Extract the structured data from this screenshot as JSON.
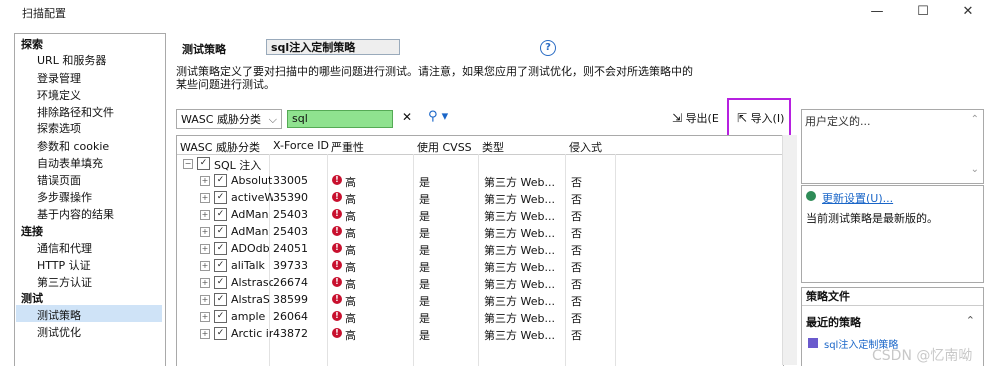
{
  "window": {
    "title": "扫描配置",
    "min": "—",
    "max": "☐",
    "close": "✕"
  },
  "nav": {
    "sections": [
      {
        "label": "探索",
        "items": [
          "URL 和服务器",
          "登录管理",
          "环境定义",
          "排除路径和文件",
          "探索选项",
          "参数和 cookie",
          "自动表单填充",
          "错误页面",
          "多步骤操作",
          "基于内容的结果"
        ]
      },
      {
        "label": "连接",
        "items": [
          "通信和代理",
          "HTTP 认证",
          "第三方认证"
        ]
      },
      {
        "label": "测试",
        "items": [
          "测试策略",
          "测试优化"
        ]
      }
    ],
    "selected": "测试策略"
  },
  "policy": {
    "label": "测试策略",
    "name": "sql注入定制策略",
    "help": "?"
  },
  "description": {
    "line1": "测试策略定义了要对扫描中的哪些问题进行测试。请注意，如果您应用了测试优化，则不会对所选策略中的",
    "line2": "某些问题进行测试。"
  },
  "toolbar": {
    "wasc_select": "WASC 威胁分类",
    "search_value": "sql",
    "clear": "✕",
    "search_icon": "⚲ ▾",
    "export": "导出(E",
    "import": "导入(I)"
  },
  "table": {
    "columns": [
      "WASC 威胁分类",
      "X-Force ID",
      "严重性",
      "使用 CVSS",
      "类型",
      "侵入式"
    ],
    "group": "SQL 注入",
    "rows": [
      {
        "name": "Absolut",
        "xforce": "33005",
        "severity": "高",
        "cvss": "是",
        "type": "第三方 Web...",
        "invasive": "否"
      },
      {
        "name": "activeW",
        "xforce": "35390",
        "severity": "高",
        "cvss": "是",
        "type": "第三方 Web...",
        "invasive": "否"
      },
      {
        "name": "AdMan",
        "xforce": "25403",
        "severity": "高",
        "cvss": "是",
        "type": "第三方 Web...",
        "invasive": "否"
      },
      {
        "name": "AdMan",
        "xforce": "25403",
        "severity": "高",
        "cvss": "是",
        "type": "第三方 Web...",
        "invasive": "否"
      },
      {
        "name": "ADOdb",
        "xforce": "24051",
        "severity": "高",
        "cvss": "是",
        "type": "第三方 Web...",
        "invasive": "否"
      },
      {
        "name": "aliTalk",
        "xforce": "39733",
        "severity": "高",
        "cvss": "是",
        "type": "第三方 Web...",
        "invasive": "否"
      },
      {
        "name": "Alstrasc",
        "xforce": "26674",
        "severity": "高",
        "cvss": "是",
        "type": "第三方 Web...",
        "invasive": "否"
      },
      {
        "name": "AlstraS",
        "xforce": "38599",
        "severity": "高",
        "cvss": "是",
        "type": "第三方 Web...",
        "invasive": "否"
      },
      {
        "name": "ample",
        "xforce": "26064",
        "severity": "高",
        "cvss": "是",
        "type": "第三方 Web...",
        "invasive": "否"
      },
      {
        "name": "Arctic in",
        "xforce": "43872",
        "severity": "高",
        "cvss": "是",
        "type": "第三方 Web...",
        "invasive": "否"
      }
    ]
  },
  "right": {
    "user_defined": "用户定义的...",
    "update_link": "更新设置(U)...",
    "status": "当前测试策略是最新版的。",
    "files_header": "策略文件",
    "recent_header": "最近的策略",
    "recent_item": "sql注入定制策略"
  },
  "watermark": "CSDN @忆南呦",
  "colors": {
    "highlight": "#b620e0",
    "search_bg": "#8fe28f",
    "severity": "#c8102e",
    "link": "#1a66c8",
    "selection": "#cfe3f7"
  }
}
